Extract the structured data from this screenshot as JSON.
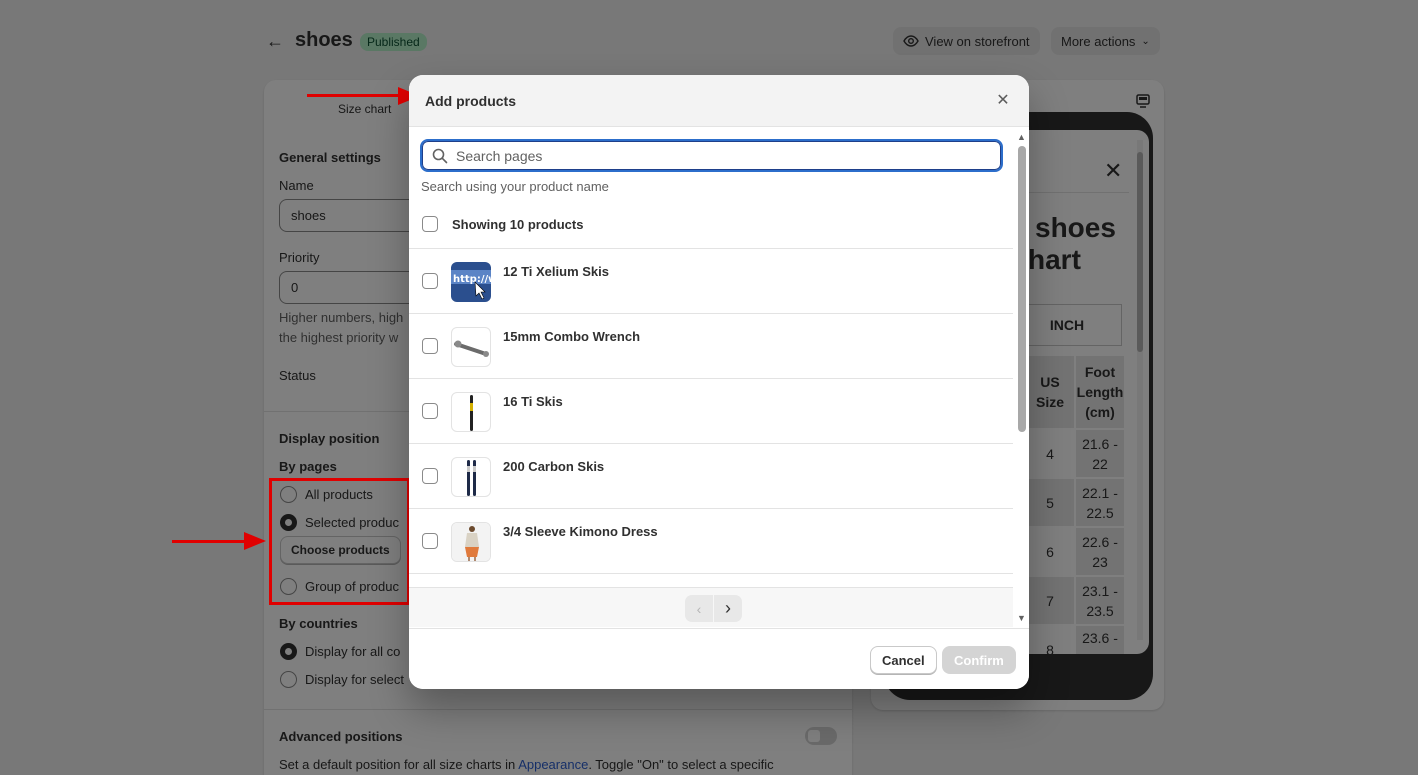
{
  "header": {
    "title": "shoes",
    "status": "Published",
    "view_storefront": "View on storefront",
    "more_actions": "More actions"
  },
  "left_card": {
    "tab_label": "Size chart",
    "general_settings": "General settings",
    "name_label": "Name",
    "name_value": "shoes",
    "priority_label": "Priority",
    "priority_value": "0",
    "priority_help_line1": "Higher numbers, high",
    "priority_help_line2": "the highest priority w",
    "status_label": "Status",
    "display_position": "Display position",
    "by_pages": "By pages",
    "opt_all": "All products",
    "opt_selected": "Selected produc",
    "choose_products": "Choose products",
    "opt_group": "Group of produc",
    "by_countries": "By countries",
    "opt_all_countries": "Display for all co",
    "opt_select_countries": "Display for select",
    "advanced_positions": "Advanced positions",
    "advanced_help_prefix": "Set a default position for all size charts in ",
    "advanced_help_link": "Appearance",
    "advanced_help_suffix": ". Toggle \"On\" to select a specific"
  },
  "preview": {
    "title_line1": "shoes",
    "title_line2": "hart",
    "unit_button": "INCH",
    "col_us": "US Size",
    "col_foot": "Foot Length (cm)",
    "rows": [
      {
        "us": "4",
        "foot": "21.6 - 22"
      },
      {
        "us": "5",
        "foot": "22.1 - 22.5"
      },
      {
        "us": "6",
        "foot": "22.6 - 23"
      },
      {
        "us": "7",
        "foot": "23.1 - 23.5"
      },
      {
        "us": "8",
        "foot": "23.6 -"
      }
    ]
  },
  "modal": {
    "title": "Add products",
    "search_placeholder": "Search pages",
    "search_hint": "Search using your product name",
    "showing": "Showing 10 products",
    "products": [
      {
        "name": "12 Ti Xelium Skis",
        "thumb": "web-image"
      },
      {
        "name": "15mm Combo Wrench",
        "thumb": "wrench"
      },
      {
        "name": "16 Ti Skis",
        "thumb": "ski"
      },
      {
        "name": "200 Carbon Skis",
        "thumb": "skis-pair"
      },
      {
        "name": "3/4 Sleeve Kimono Dress",
        "thumb": "dress"
      }
    ],
    "cancel": "Cancel",
    "confirm": "Confirm"
  }
}
